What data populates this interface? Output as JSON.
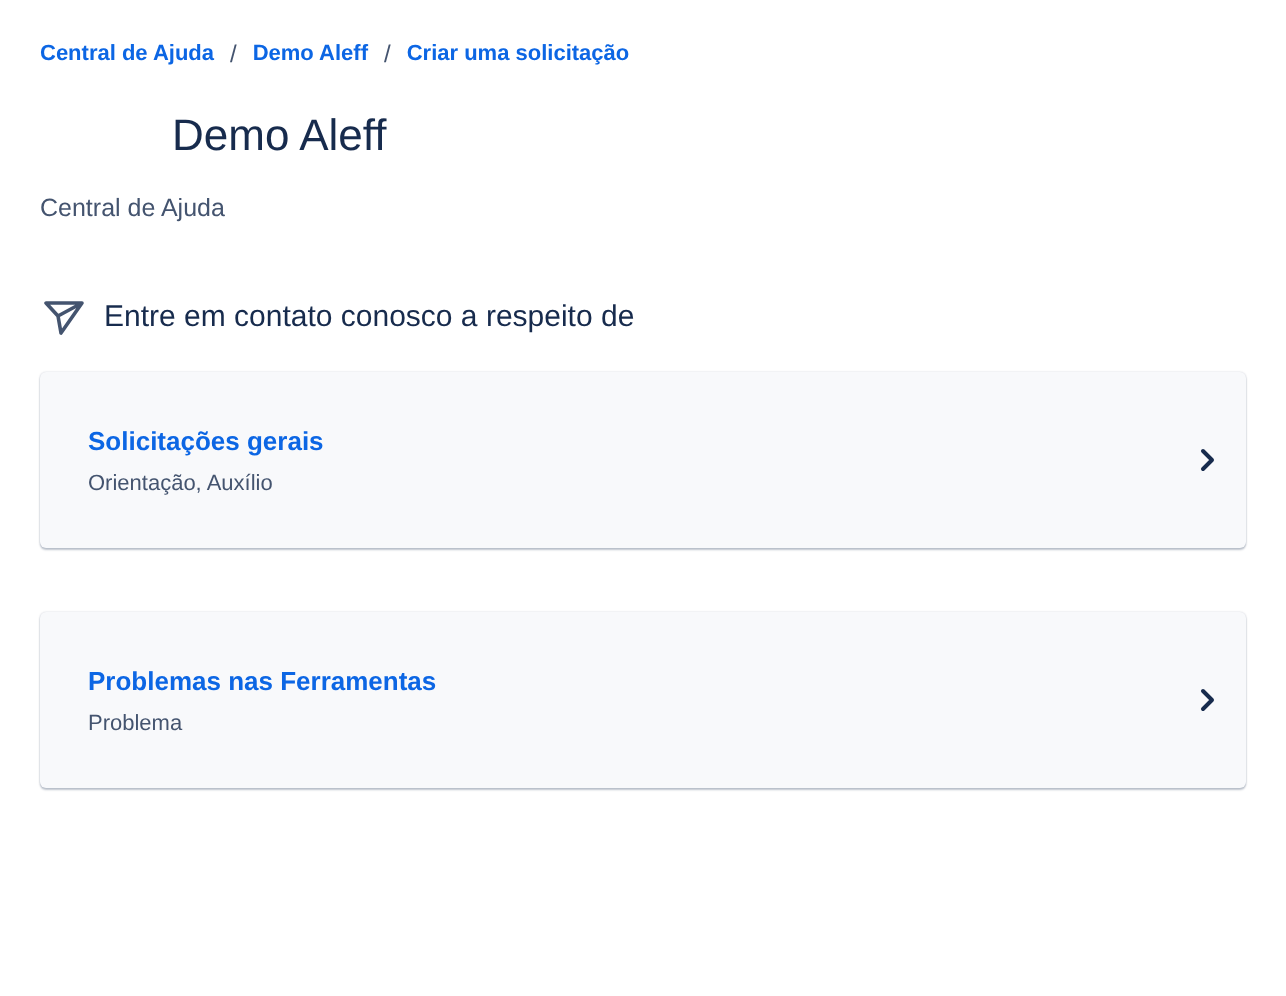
{
  "breadcrumb": [
    "Central de Ajuda",
    "Demo Aleff",
    "Criar uma solicitação"
  ],
  "breadcrumb_separator": "/",
  "title": "Demo Aleff",
  "subtitle": "Central de Ajuda",
  "section_heading": "Entre em contato conosco a respeito de",
  "request_types": [
    {
      "title": "Solicitações gerais",
      "description": "Orientação, Auxílio"
    },
    {
      "title": "Problemas nas Ferramentas",
      "description": "Problema"
    }
  ]
}
